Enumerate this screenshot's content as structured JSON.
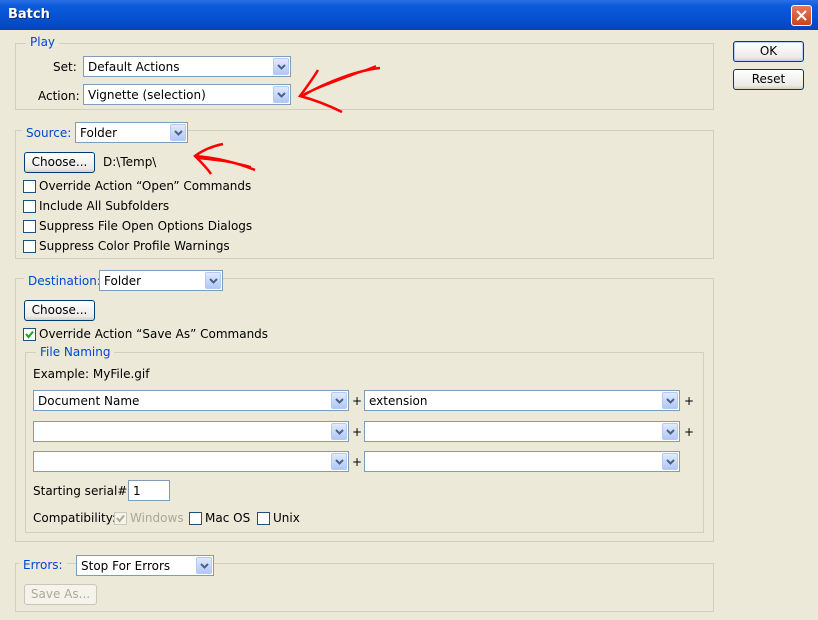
{
  "window": {
    "title": "Batch"
  },
  "buttons": {
    "ok": "OK",
    "reset": "Reset"
  },
  "play": {
    "legend": "Play",
    "set_label": "Set:",
    "set_value": "Default Actions",
    "action_label": "Action:",
    "action_value": "Vignette (selection)"
  },
  "source": {
    "label": "Source:",
    "value": "Folder",
    "choose": "Choose...",
    "path": "D:\\Temp\\",
    "checkboxes": [
      {
        "label": "Override Action “Open” Commands",
        "checked": false
      },
      {
        "label": "Include All Subfolders",
        "checked": false
      },
      {
        "label": "Suppress File Open Options Dialogs",
        "checked": false
      },
      {
        "label": "Suppress Color Profile Warnings",
        "checked": false
      }
    ]
  },
  "destination": {
    "label": "Destination:",
    "value": "Folder",
    "choose": "Choose...",
    "override_label": "Override Action “Save As” Commands",
    "override_checked": true,
    "file_naming": {
      "legend": "File Naming",
      "example": "Example: MyFile.gif",
      "rows": [
        {
          "left": "Document Name",
          "right": "extension"
        },
        {
          "left": "",
          "right": ""
        },
        {
          "left": "",
          "right": ""
        }
      ],
      "plus": "+",
      "serial_label": "Starting serial#:",
      "serial_value": "1",
      "compat_label": "Compatibility:",
      "compat": [
        {
          "label": "Windows",
          "checked": true,
          "disabled": true
        },
        {
          "label": "Mac OS",
          "checked": false,
          "disabled": false
        },
        {
          "label": "Unix",
          "checked": false,
          "disabled": false
        }
      ]
    }
  },
  "errors": {
    "label": "Errors:",
    "value": "Stop For Errors",
    "save_as": "Save As..."
  },
  "colors": {
    "annotation": "#FF0000",
    "titlebar": "#0552D0",
    "legend": "#0046D5",
    "dialog_bg": "#ECE9D8"
  },
  "icons": [
    "close-icon",
    "chevron-down-icon",
    "checkmark-icon"
  ]
}
